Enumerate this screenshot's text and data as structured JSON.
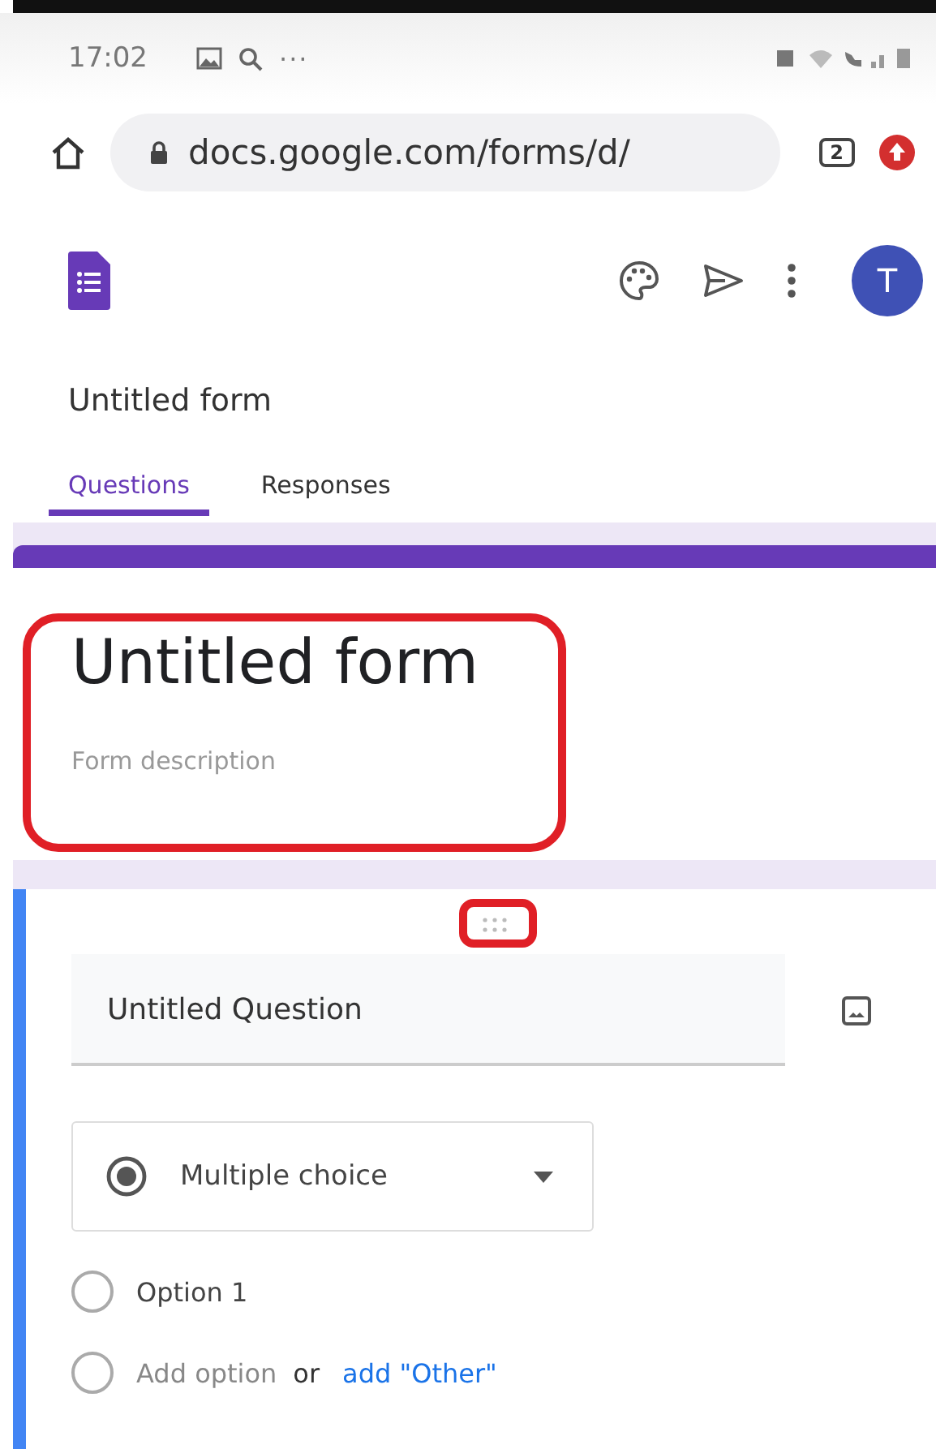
{
  "status_bar": {
    "time": "17:02",
    "more": "···"
  },
  "browser": {
    "url": "docs.google.com/forms/d/",
    "tab_count": "2"
  },
  "app": {
    "avatar": "T",
    "form_name": "Untitled form"
  },
  "tabs": [
    {
      "label": "Questions",
      "selected": true
    },
    {
      "label": "Responses",
      "selected": false
    }
  ],
  "form_header": {
    "title": "Untitled form",
    "description_placeholder": "Form description"
  },
  "question": {
    "title": "Untitled Question",
    "type": "Multiple choice",
    "options": [
      {
        "label": "Option 1",
        "checked": false
      }
    ],
    "add_option": "Add option",
    "add_option_checked": false,
    "or": "or",
    "add_other": "add \"Other\""
  }
}
